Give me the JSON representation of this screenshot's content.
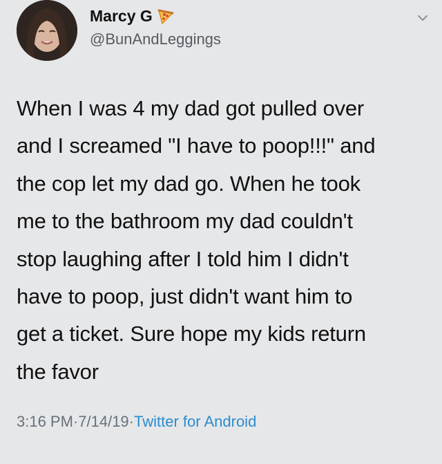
{
  "user": {
    "display_name": "Marcy G",
    "handle": "@BunAndLeggings",
    "name_emoji_icon": "pizza-icon"
  },
  "tweet": {
    "text": "When I was 4 my dad got pulled over\nand I screamed \"I have to poop!!!\" and\nthe cop let my dad go. When he took\nme to the bathroom my dad couldn't\nstop laughing after I told him I didn't\nhave to poop, just didn't want him to\nget a ticket. Sure hope my kids return\nthe favor",
    "time": "3:16 PM",
    "separator": " · ",
    "date": "7/14/19",
    "source": "Twitter for Android"
  },
  "colors": {
    "background": "#e6e7e9",
    "text": "#111111",
    "meta": "#66717a",
    "link": "#2c8ccf"
  },
  "icons": {
    "menu": "chevron-down-icon",
    "avatar": "profile-photo"
  }
}
